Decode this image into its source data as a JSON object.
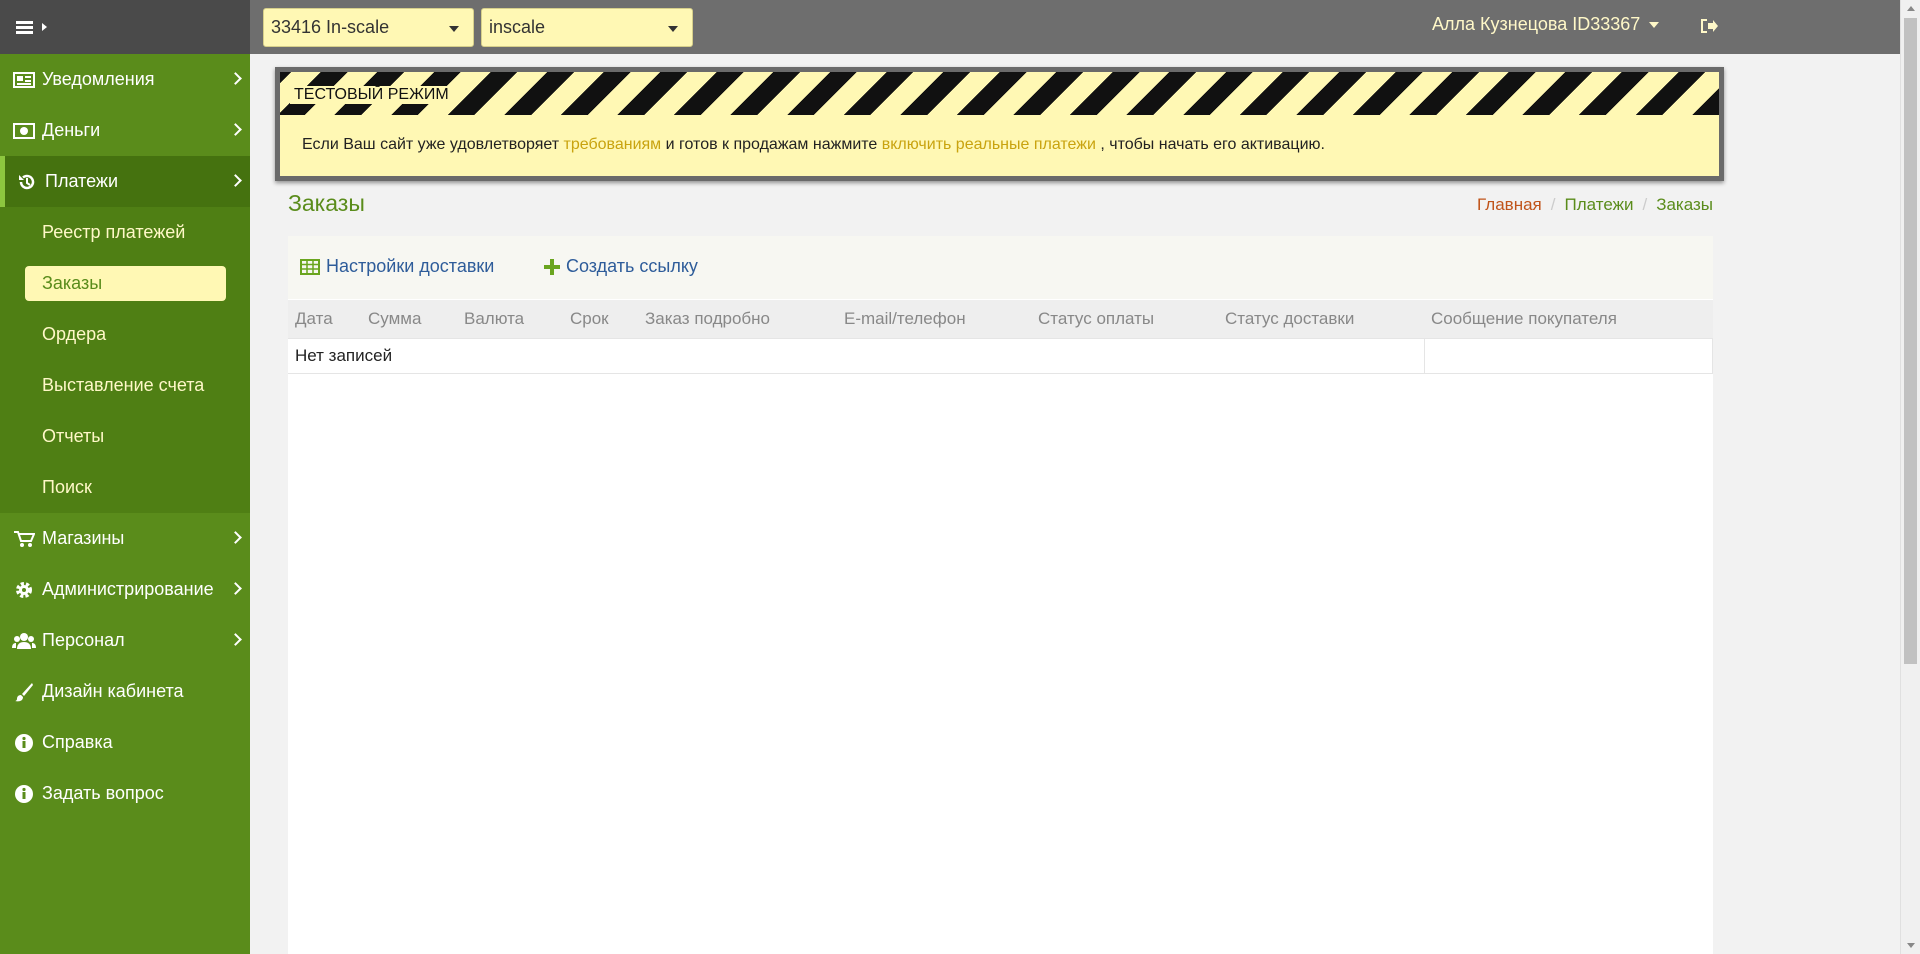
{
  "topbar": {
    "company_select": "33416 In-scale",
    "shop_select": "inscale",
    "user_name": "Алла Кузнецова ID33367"
  },
  "sidebar": {
    "items": [
      {
        "label": "Уведомления",
        "icon": "newspaper-icon"
      },
      {
        "label": "Деньги",
        "icon": "money-icon"
      },
      {
        "label": "Платежи",
        "icon": "history-icon"
      },
      {
        "label": "Магазины",
        "icon": "cart-icon"
      },
      {
        "label": "Администрирование",
        "icon": "gear-icon"
      },
      {
        "label": "Персонал",
        "icon": "users-icon"
      },
      {
        "label": "Дизайн кабинета",
        "icon": "brush-icon"
      },
      {
        "label": "Справка",
        "icon": "info-icon"
      },
      {
        "label": "Задать вопрос",
        "icon": "info-icon"
      }
    ],
    "payments_sub": [
      "Реестр платежей",
      "Заказы",
      "Ордера",
      "Выставление счета",
      "Отчеты",
      "Поиск"
    ]
  },
  "banner": {
    "tag": "ТЕСТОВЫЙ РЕЖИМ",
    "text_1": "Если Ваш сайт уже удовлетворяет ",
    "link_1": "требованиям",
    "text_2": " и готов к продажам нажмите ",
    "link_2": "включить реальные платежи",
    "text_3": " , чтобы начать его активацию."
  },
  "page": {
    "title": "Заказы",
    "breadcrumb": [
      "Главная",
      "Платежи",
      "Заказы"
    ]
  },
  "toolbar": {
    "delivery_settings": "Настройки доставки",
    "create_link": "Создать ссылку"
  },
  "table": {
    "columns": [
      "Дата",
      "Сумма",
      "Валюта",
      "Срок",
      "Заказ подробно",
      "E-mail/телефон",
      "Статус оплаты",
      "Статус доставки",
      "Сообщение покупателя"
    ],
    "empty_text": "Нет записей"
  },
  "colors": {
    "sidebar_bg": "#5a8c1b",
    "sidebar_active": "#45720f",
    "topbar_bg": "#6e6e6e",
    "accent_yellow": "#fff8b4",
    "link_blue": "#2e5c9a",
    "title_green": "#5a8c1b",
    "home_orange": "#c0541a"
  }
}
